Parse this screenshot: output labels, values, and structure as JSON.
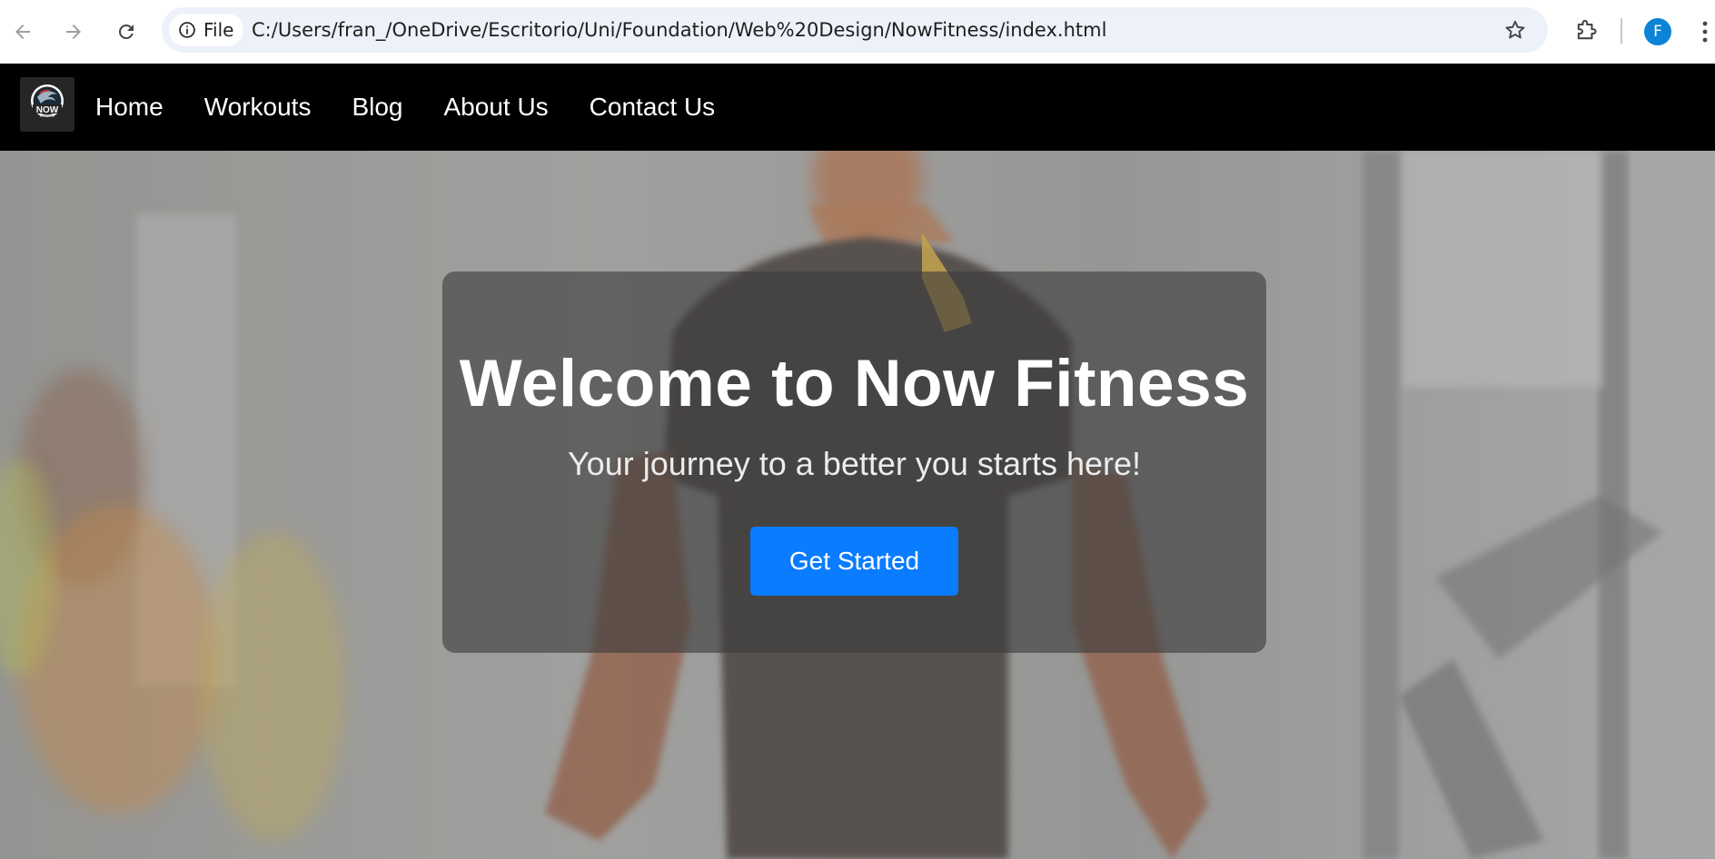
{
  "browser": {
    "site_chip_label": "File",
    "url": "C:/Users/fran_/OneDrive/Escritorio/Uni/Foundation/Web%20Design/NowFitness/index.html",
    "profile_initial": "F",
    "icons": [
      "back-arrow-icon",
      "forward-arrow-icon",
      "reload-icon",
      "info-icon",
      "star-icon",
      "extensions-icon",
      "more-vert-icon"
    ]
  },
  "header": {
    "logo_text": "NOW",
    "nav": [
      {
        "label": "Home"
      },
      {
        "label": "Workouts"
      },
      {
        "label": "Blog"
      },
      {
        "label": "About Us"
      },
      {
        "label": "Contact Us"
      }
    ]
  },
  "hero": {
    "title": "Welcome to Now Fitness",
    "subtitle": "Your journey to a better you starts here!",
    "cta_label": "Get Started"
  },
  "colors": {
    "header_bg": "#000000",
    "cta_bg": "#0a7cff",
    "omnibox_bg": "#edf1f9",
    "avatar_bg": "#0b84d6"
  }
}
